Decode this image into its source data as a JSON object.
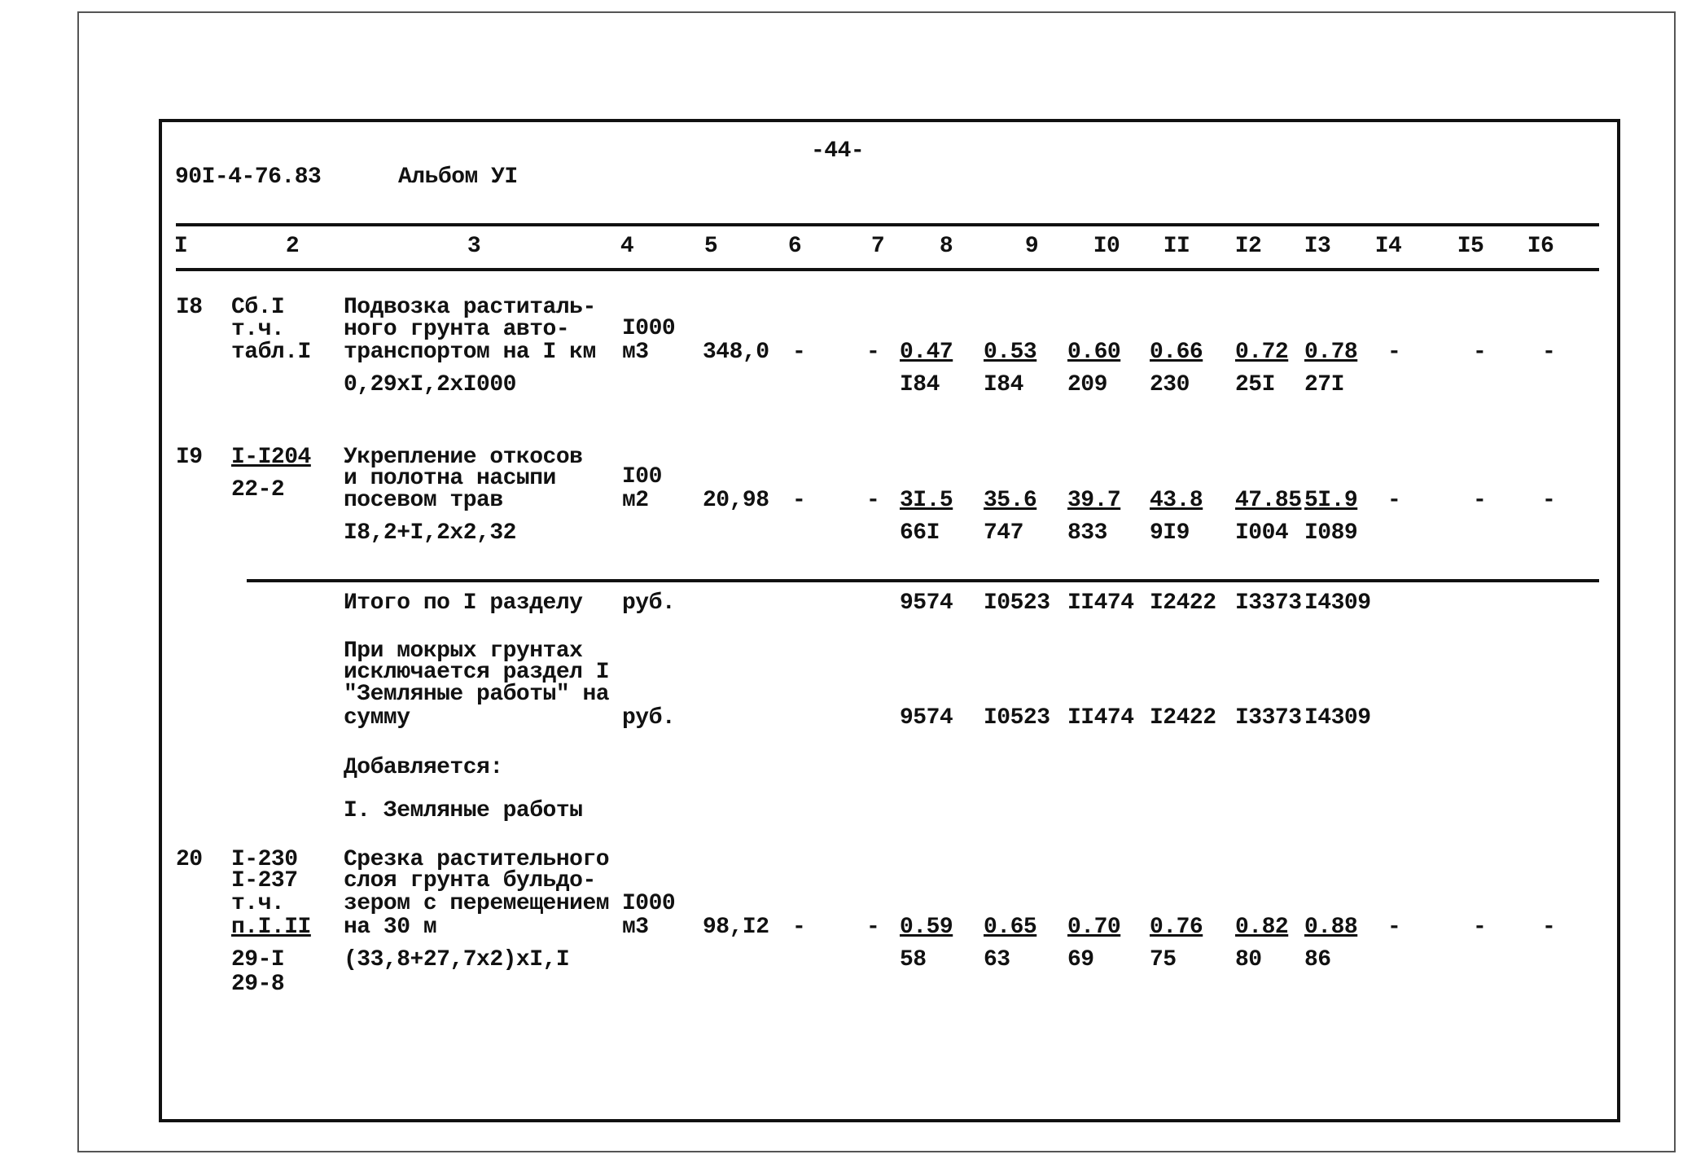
{
  "header": {
    "doc_code": "90I-4-76.83",
    "album": "Альбом УI",
    "page_number": "-44-"
  },
  "columns": [
    "I",
    "2",
    "3",
    "4",
    "5",
    "6",
    "7",
    "8",
    "9",
    "I0",
    "II",
    "I2",
    "I3",
    "I4",
    "I5",
    "I6"
  ],
  "rows": [
    {
      "num": "I8",
      "ref": [
        "Сб.I",
        "т.ч.",
        "табл.I"
      ],
      "desc": [
        "Подвозка раститаль-",
        "ного грунта авто-",
        "транспортом на I км"
      ],
      "formula": "0,29xI,2xI000",
      "unit": [
        "I000",
        "м3"
      ],
      "qty": "348,0",
      "c6": "-",
      "c7": "-",
      "top": [
        "0.47",
        "0.53",
        "0.60",
        "0.66",
        "0.72",
        "0.78"
      ],
      "bottom": [
        "I84",
        "I84",
        "209",
        "230",
        "25I",
        "27I"
      ],
      "c14": "-",
      "c15": "-",
      "c16": "-"
    },
    {
      "num": "I9",
      "ref": [
        "I-I204",
        "22-2"
      ],
      "desc": [
        "Укрепление откосов",
        "и полотна насыпи",
        "посевом трав"
      ],
      "formula": "I8,2+I,2x2,32",
      "unit": [
        "I00",
        "м2"
      ],
      "qty": "20,98",
      "c6": "-",
      "c7": "-",
      "top": [
        "3I.5",
        "35.6",
        "39.7",
        "43.8",
        "47.85",
        "5I.9"
      ],
      "bottom": [
        "66I",
        "747",
        "833",
        "9I9",
        "I004",
        "I089"
      ],
      "c14": "-",
      "c15": "-",
      "c16": "-"
    },
    {
      "num": "20",
      "ref": [
        "I-230",
        "I-237",
        "т.ч.",
        "п.I.II",
        "29-I",
        "29-8"
      ],
      "desc": [
        "Срезка растительного",
        "слоя грунта бульдо-",
        "зером с перемещением",
        "на 30 м"
      ],
      "formula": "(33,8+27,7x2)xI,I",
      "unit": [
        "I000",
        "м3"
      ],
      "qty": "98,I2",
      "c6": "-",
      "c7": "-",
      "top": [
        "0.59",
        "0.65",
        "0.70",
        "0.76",
        "0.82",
        "0.88"
      ],
      "bottom": [
        "58",
        "63",
        "69",
        "75",
        "80",
        "86"
      ],
      "c14": "-",
      "c15": "-",
      "c16": "-"
    }
  ],
  "total": {
    "label": "Итого по I разделу",
    "unit": "руб.",
    "values": [
      "9574",
      "I0523",
      "II474",
      "I2422",
      "I3373",
      "I4309"
    ]
  },
  "wet": {
    "lines": [
      "При мокрых грунтах",
      "исключается раздел I",
      "\"Земляные работы\" на",
      "сумму"
    ],
    "unit": "руб.",
    "values": [
      "9574",
      "I0523",
      "II474",
      "I2422",
      "I3373",
      "I4309"
    ]
  },
  "added": {
    "label": "Добавляется:",
    "section": "I. Земляные работы"
  }
}
